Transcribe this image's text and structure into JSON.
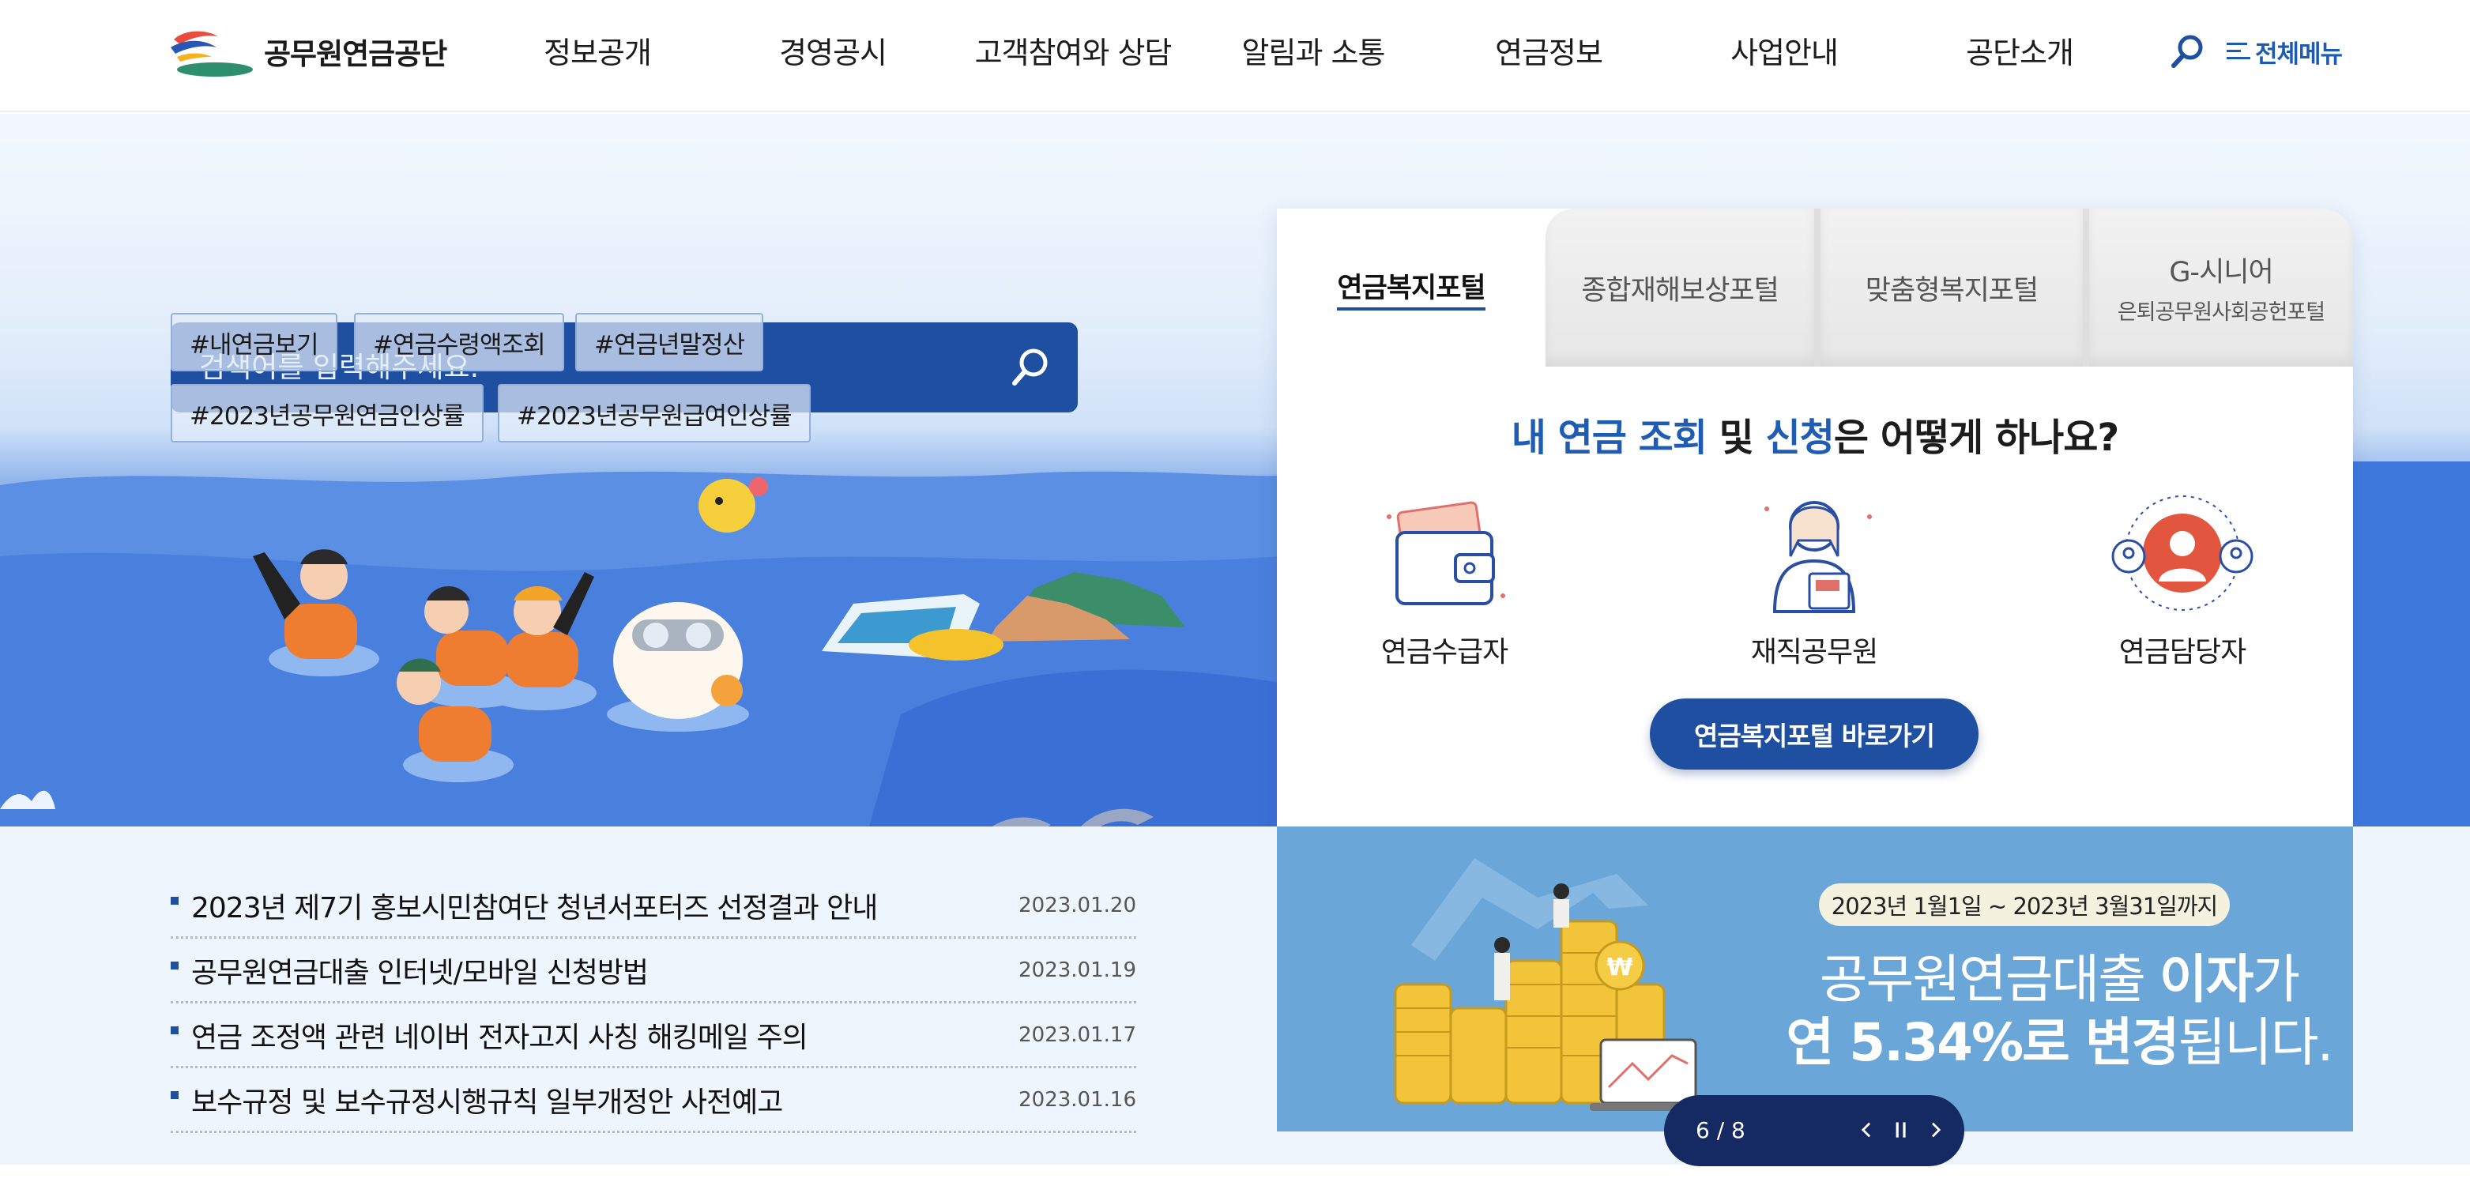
{
  "header": {
    "org_name": "공무원연금공단",
    "nav": [
      "정보공개",
      "경영공시",
      "고객참여와 상담",
      "알림과 소통",
      "연금정보",
      "사업안내",
      "공단소개"
    ],
    "all_menu_label": "전체메뉴"
  },
  "search": {
    "placeholder": "검색어를 입력해주세요.",
    "tags": [
      "#내연금보기",
      "#연금수령액조회",
      "#연금년말정산",
      "#2023년공무원연금인상률",
      "#2023년공무원급여인상률"
    ]
  },
  "portal": {
    "tabs": [
      {
        "label": "연금복지포털",
        "sub": ""
      },
      {
        "label": "종합재해보상포털",
        "sub": ""
      },
      {
        "label": "맞춤형복지포털",
        "sub": ""
      },
      {
        "label": "G-시니어",
        "sub": "은퇴공무원사회공헌포털"
      }
    ],
    "question_hl1": "내 연금 조회",
    "question_mid": " 및 ",
    "question_hl2": "신청",
    "question_rest": "은 어떻게 하나요?",
    "personas": [
      "연금수급자",
      "재직공무원",
      "연금담당자"
    ],
    "button_label": "연금복지포털 바로가기"
  },
  "news": [
    {
      "title": "2023년 제7기 홍보시민참여단 청년서포터즈 선정결과 안내",
      "date": "2023.01.20"
    },
    {
      "title": "공무원연금대출 인터넷/모바일 신청방법",
      "date": "2023.01.19"
    },
    {
      "title": "연금 조정액 관련 네이버 전자고지 사칭 해킹메일 주의",
      "date": "2023.01.17"
    },
    {
      "title": "보수규정 및 보수규정시행규칙 일부개정안 사전예고",
      "date": "2023.01.16"
    }
  ],
  "banner": {
    "period": "2023년 1월1일 ~ 2023년 3월31일까지",
    "line1_a": "공무원연금대출 ",
    "line1_b": "이자",
    "line1_c": "가",
    "line2_a": "연 5.34%로 변경",
    "line2_b": "됩니다.",
    "coin_symbol": "₩"
  },
  "pager": {
    "current": 6,
    "total": 8,
    "label": "6 / 8"
  },
  "colors": {
    "brand_navy": "#1f4fa0",
    "hero_blue": "#3872d8",
    "banner_blue": "#6aa7d8",
    "pager_navy": "#152a63"
  }
}
